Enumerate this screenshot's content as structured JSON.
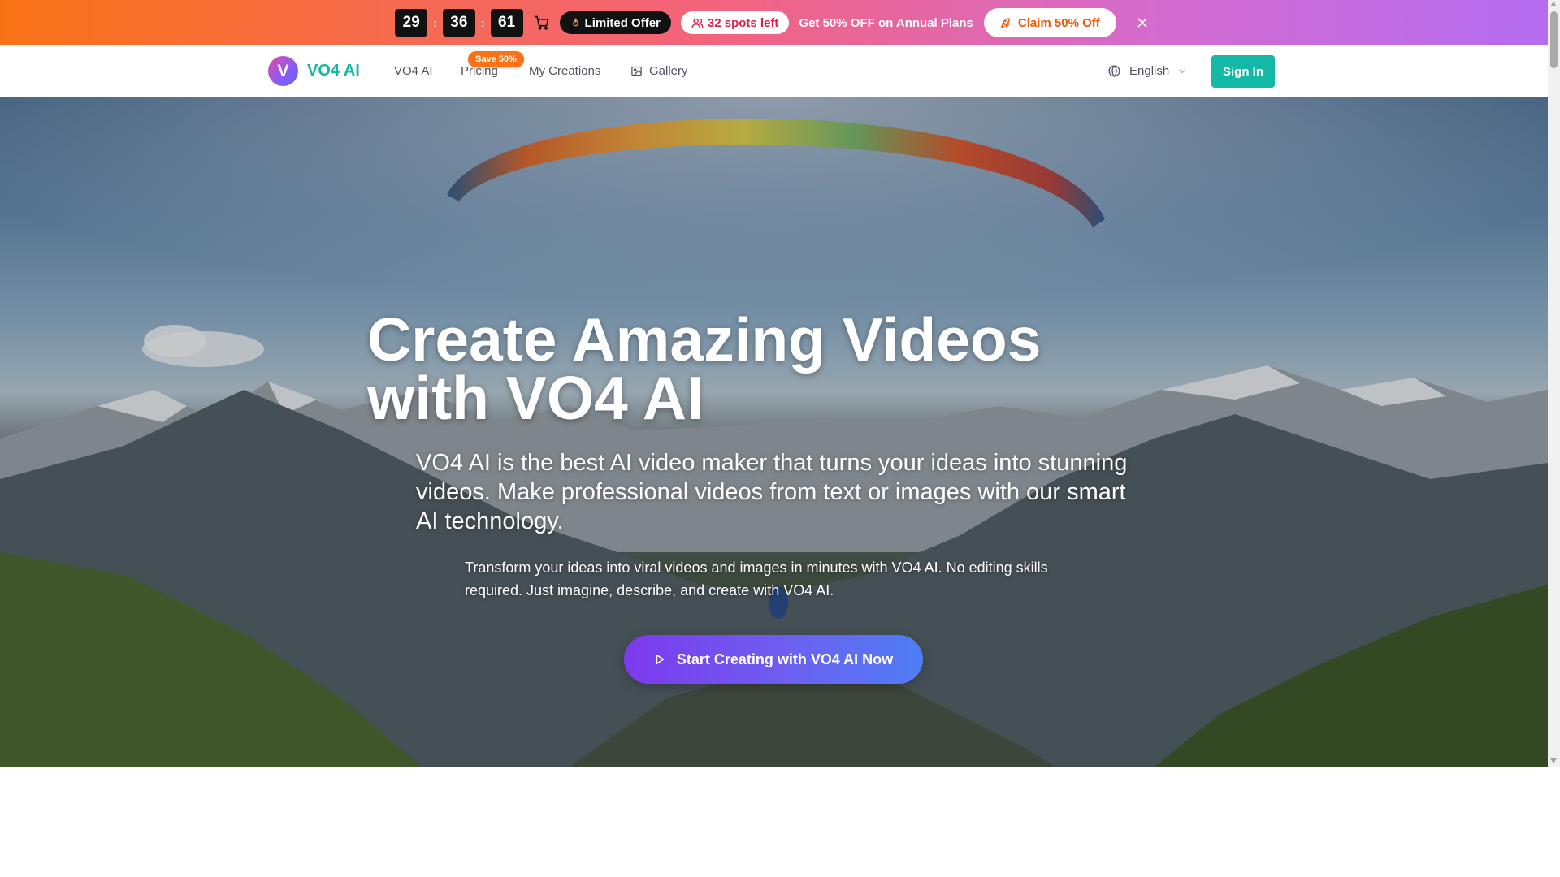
{
  "promo": {
    "timer": {
      "days": "29",
      "hours": "36",
      "minutes": "61",
      "separator": ":"
    },
    "limited_offer_label": "Limited Offer",
    "spots_label": "32 spots left",
    "offer_text": "Get 50% OFF on Annual Plans",
    "claim_label": "Claim 50% Off",
    "icons": [
      "cart-icon",
      "flame-icon",
      "users-icon",
      "rocket-icon",
      "close-icon"
    ]
  },
  "nav": {
    "brand": "VO4 AI",
    "logo_letter": "V",
    "links": {
      "vo4": "VO4 AI",
      "pricing": "Pricing",
      "creations": "My Creations",
      "gallery": "Gallery"
    },
    "pricing_badge": "Save 50%",
    "language": "English",
    "signin_label": "Sign In"
  },
  "hero": {
    "title_line1": "Create Amazing Videos",
    "title_line2": "with VO4 AI",
    "subtitle": "VO4 AI is the best AI video maker that turns your ideas into stunning videos. Make professional videos from text or images with our smart AI technology.",
    "description": "Transform your ideas into viral videos and images in minutes with VO4 AI. No editing skills required. Just imagine, describe, and create with VO4 AI.",
    "cta_label": "Start Creating with VO4 AI Now"
  },
  "colors": {
    "brand_teal": "#14b8a6",
    "cta_purple": "#7c3aed",
    "badge_orange": "#f97316",
    "promo_gradient_start": "#f97316",
    "promo_gradient_end": "#b46cf0"
  }
}
